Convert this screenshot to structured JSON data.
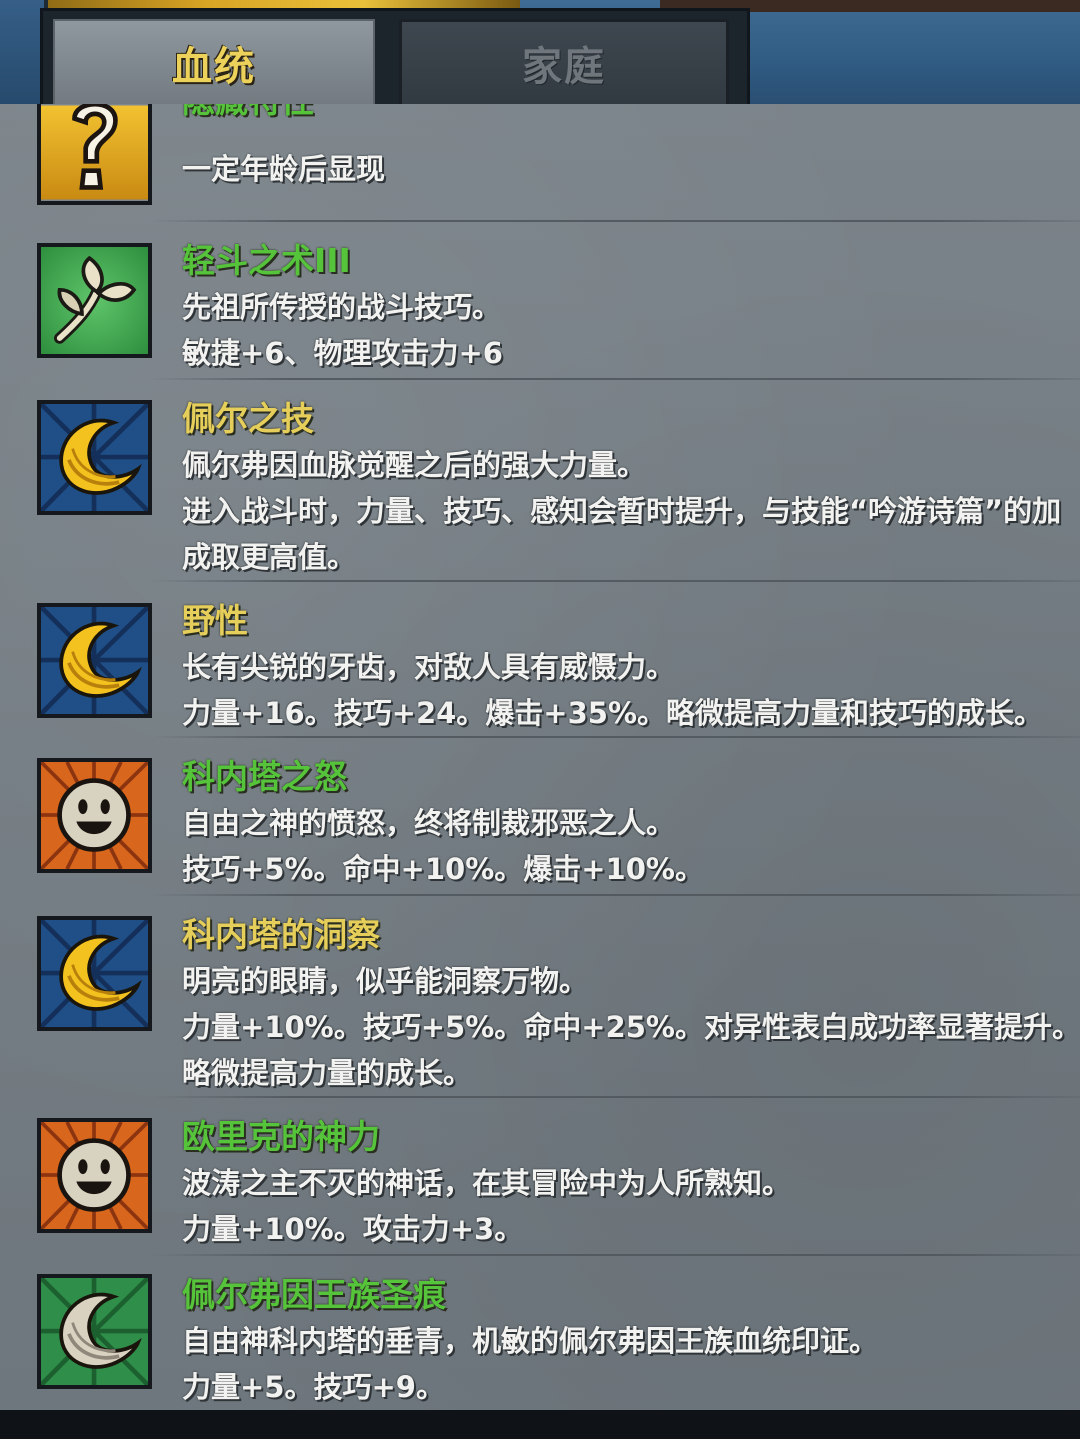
{
  "tabs": {
    "bloodline": "血统",
    "family": "家庭"
  },
  "traits": [
    {
      "icon": "question-icon",
      "name": "隐藏特性",
      "name_color": "green",
      "lines": [
        "一定年龄后显现"
      ]
    },
    {
      "icon": "sprout-icon",
      "name": "轻斗之术III",
      "name_color": "green",
      "lines": [
        "先祖所传授的战斗技巧。",
        "敏捷+6、物理攻击力+6"
      ]
    },
    {
      "icon": "crescent-moon-icon",
      "name": "佩尔之技",
      "name_color": "gold",
      "lines": [
        "佩尔弗因血脉觉醒之后的强大力量。",
        "进入战斗时，力量、技巧、感知会暂时提升，与技能“吟游诗篇”的加",
        "成取更高值。"
      ]
    },
    {
      "icon": "crescent-moon-icon",
      "name": "野性",
      "name_color": "gold",
      "lines": [
        "长有尖锐的牙齿，对敌人具有威慑力。",
        "力量+16。技巧+24。爆击+35%。略微提高力量和技巧的成长。"
      ]
    },
    {
      "icon": "smiling-face-icon",
      "name": "科内塔之怒",
      "name_color": "green",
      "lines": [
        "自由之神的愤怒，终将制裁邪恶之人。",
        "技巧+5%。命中+10%。爆击+10%。"
      ]
    },
    {
      "icon": "crescent-moon-icon",
      "name": "科内塔的洞察",
      "name_color": "gold",
      "lines": [
        "明亮的眼睛，似乎能洞察万物。",
        "力量+10%。技巧+5%。命中+25%。对异性表白成功率显著提升。",
        "略微提高力量的成长。"
      ]
    },
    {
      "icon": "smiling-face-icon",
      "name": "欧里克的神力",
      "name_color": "green",
      "lines": [
        "波涛之主不灭的神话，在其冒险中为人所熟知。",
        "力量+10%。攻击力+3。"
      ]
    },
    {
      "icon": "silver-crescent-icon",
      "name": "佩尔弗因王族圣痕",
      "name_color": "green",
      "lines": [
        "自由神科内塔的垂青，机敏的佩尔弗因王族血统印证。",
        "力量+5。技巧+9。"
      ]
    }
  ]
}
